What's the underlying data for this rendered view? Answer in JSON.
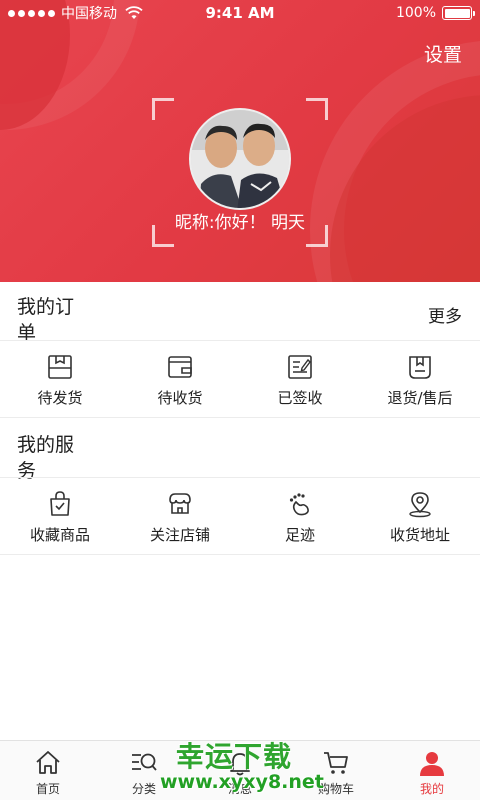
{
  "status_bar": {
    "carrier": "中国移动",
    "time": "9:41 AM",
    "battery": "100%",
    "battery_level": 1.0
  },
  "header": {
    "settings_label": "设置",
    "nickname": "昵称:你好！ 明天"
  },
  "orders": {
    "title": "我的订单",
    "more_label": "更多",
    "items": [
      {
        "label": "待发货",
        "icon": "box-icon"
      },
      {
        "label": "待收货",
        "icon": "wallet-icon"
      },
      {
        "label": "已签收",
        "icon": "signed-doc-icon"
      },
      {
        "label": "退货/售后",
        "icon": "return-box-icon"
      }
    ]
  },
  "services": {
    "title": "我的服务",
    "items": [
      {
        "label": "收藏商品",
        "icon": "shopping-bag-icon"
      },
      {
        "label": "关注店铺",
        "icon": "store-icon"
      },
      {
        "label": "足迹",
        "icon": "footprint-icon"
      },
      {
        "label": "收货地址",
        "icon": "location-pin-icon"
      }
    ]
  },
  "tabbar": {
    "items": [
      {
        "label": "首页",
        "icon": "home-icon"
      },
      {
        "label": "分类",
        "icon": "category-search-icon"
      },
      {
        "label": "消息",
        "icon": "bell-icon"
      },
      {
        "label": "购物车",
        "icon": "cart-icon"
      },
      {
        "label": "我的",
        "icon": "user-icon",
        "active": true
      }
    ]
  },
  "watermark": {
    "line1": "幸运下载",
    "line2": "www.xyxy8.net"
  },
  "colors": {
    "brand_red": "#e63a3f",
    "header_red": "#e23a44",
    "watermark_green": "#2fa52f"
  }
}
